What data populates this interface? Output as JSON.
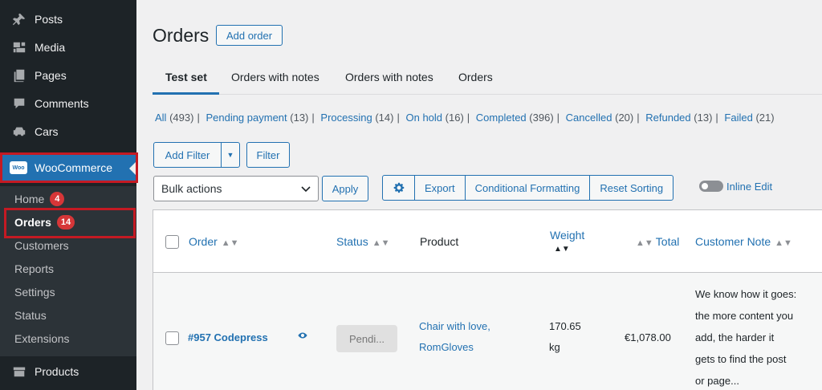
{
  "sidebar": {
    "items": [
      {
        "label": "Posts",
        "icon": "pin-icon"
      },
      {
        "label": "Media",
        "icon": "media-icon"
      },
      {
        "label": "Pages",
        "icon": "pages-icon"
      },
      {
        "label": "Comments",
        "icon": "comment-icon"
      },
      {
        "label": "Cars",
        "icon": "car-icon"
      }
    ],
    "woocommerce": {
      "label": "WooCommerce",
      "logo": "Woo"
    },
    "submenu": [
      {
        "label": "Home",
        "badge": "4"
      },
      {
        "label": "Orders",
        "badge": "14"
      },
      {
        "label": "Customers"
      },
      {
        "label": "Reports"
      },
      {
        "label": "Settings"
      },
      {
        "label": "Status"
      },
      {
        "label": "Extensions"
      }
    ],
    "products": {
      "label": "Products",
      "icon": "products-icon"
    }
  },
  "header": {
    "title": "Orders",
    "add_order": "Add order"
  },
  "tabs": [
    "Test set",
    "Orders with notes",
    "Orders with notes",
    "Orders"
  ],
  "filters": {
    "all": "All",
    "all_count": "(493)",
    "pending": "Pending payment",
    "pending_count": "(13)",
    "processing": "Processing",
    "processing_count": "(14)",
    "onhold": "On hold",
    "onhold_count": "(16)",
    "completed": "Completed",
    "completed_count": "(396)",
    "cancelled": "Cancelled",
    "cancelled_count": "(20)",
    "refunded": "Refunded",
    "refunded_count": "(13)",
    "failed": "Failed",
    "failed_count": "(21)"
  },
  "toolbar": {
    "add_filter": "Add Filter",
    "filter": "Filter",
    "bulk_actions": "Bulk actions",
    "apply": "Apply",
    "export": "Export",
    "conditional_formatting": "Conditional Formatting",
    "reset_sorting": "Reset Sorting",
    "inline_edit": "Inline Edit"
  },
  "table": {
    "columns": {
      "order": "Order",
      "status": "Status",
      "product": "Product",
      "weight": "Weight",
      "total": "Total",
      "note": "Customer Note"
    },
    "row": {
      "order": "#957 Codepress",
      "status": "Pendi...",
      "product_line1": "Chair with love,",
      "product_line2": "RomGloves",
      "weight_line1": "170.65",
      "weight_line2": "kg",
      "total": "€1,078.00",
      "note_lines": [
        "We know how it goes:",
        "the more content you",
        "add, the harder it",
        "gets to find the post",
        "or page..."
      ]
    }
  },
  "colors": {
    "accent": "#2271b1",
    "sidebar": "#1d2327",
    "highlight": "#c41a23",
    "badge": "#d63638"
  }
}
